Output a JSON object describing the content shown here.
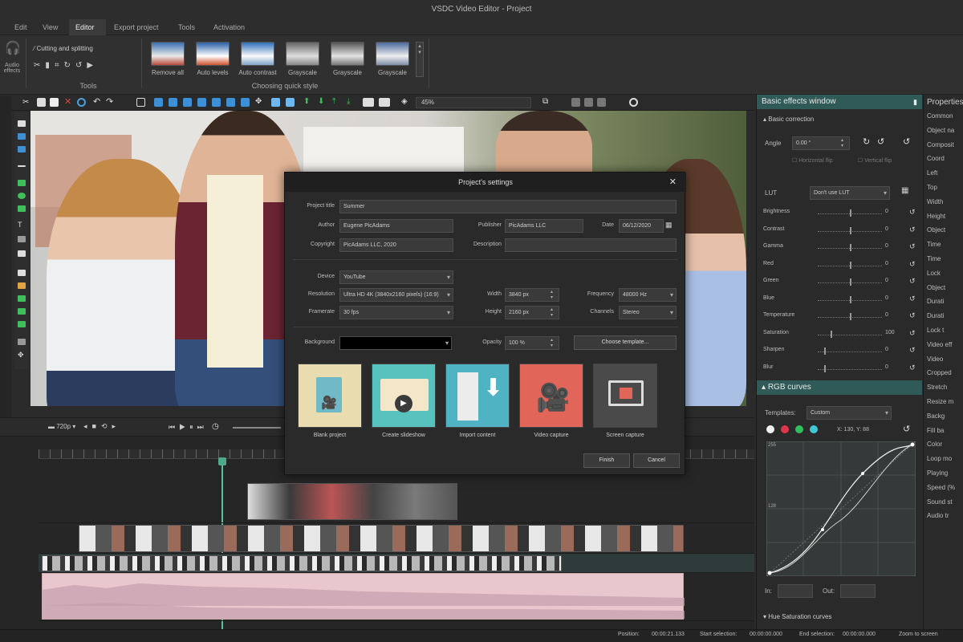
{
  "window": {
    "title": "VSDC Video Editor - Project"
  },
  "menu": {
    "items": [
      "Edit",
      "View",
      "Editor",
      "Export project",
      "Tools",
      "Activation"
    ],
    "active": "Editor"
  },
  "ribbon": {
    "audio_effects": "Audio effects",
    "cutting": "Cutting and splitting",
    "tools_label": "Tools",
    "quick_style_label": "Choosing quick style",
    "quick_styles": [
      "Remove all",
      "Auto levels",
      "Auto contrast",
      "Grayscale",
      "Grayscale",
      "Grayscale"
    ]
  },
  "toolbar": {
    "zoom": "45%"
  },
  "dialog": {
    "title": "Project's settings",
    "labels": {
      "project_title": "Project title",
      "author": "Author",
      "publisher": "Publisher",
      "date": "Date",
      "copyright": "Copyright",
      "description": "Description",
      "device": "Device",
      "resolution": "Resolution",
      "width": "Width",
      "frequency": "Frequency",
      "framerate": "Framerate",
      "height": "Height",
      "channels": "Channels",
      "background": "Background",
      "opacity": "Opacity"
    },
    "values": {
      "project_title": "Summer",
      "author": "Eugene PicAdams",
      "publisher": "PicAdams LLC",
      "date": "06/12/2020",
      "copyright": "PicAdams LLC, 2020",
      "description": "",
      "device": "YouTube",
      "resolution": "Ultra HD 4K (3840x2160 pixels) (16:9)",
      "width": "3840 px",
      "frequency": "48000 Hz",
      "framerate": "30 fps",
      "height": "2160 px",
      "channels": "Stereo",
      "background": "",
      "opacity": "100 %"
    },
    "choose_template": "Choose template...",
    "tiles": [
      "Blank project",
      "Create slideshow",
      "Import content",
      "Video capture",
      "Screen capture"
    ],
    "finish": "Finish",
    "cancel": "Cancel"
  },
  "transport": {
    "quality": "720p"
  },
  "effects": {
    "title": "Basic effects window",
    "basic_correction": "Basic correction",
    "angle_label": "Angle",
    "angle_value": "0.00 °",
    "horizontal_flip": "Horizontal flip",
    "vertical_flip": "Vertical flip",
    "lut_label": "LUT",
    "lut_value": "Don't use LUT",
    "sliders": [
      {
        "name": "Brightness",
        "value": "0",
        "pos": 0.5
      },
      {
        "name": "Contrast",
        "value": "0",
        "pos": 0.5
      },
      {
        "name": "Gamma",
        "value": "0",
        "pos": 0.5
      },
      {
        "name": "Red",
        "value": "0",
        "pos": 0.5
      },
      {
        "name": "Green",
        "value": "0",
        "pos": 0.5
      },
      {
        "name": "Blue",
        "value": "0",
        "pos": 0.5
      },
      {
        "name": "Temperature",
        "value": "0",
        "pos": 0.5
      },
      {
        "name": "Saturation",
        "value": "100",
        "pos": 0.2
      },
      {
        "name": "Sharpen",
        "value": "0",
        "pos": 0.1
      },
      {
        "name": "Blur",
        "value": "0",
        "pos": 0.1
      }
    ],
    "rgb_title": "RGB curves",
    "templates_label": "Templates:",
    "templates_value": "Custom",
    "coords": "X: 130, Y: 88",
    "curve_axis_top": "255",
    "curve_axis_mid": "128",
    "in_label": "In:",
    "out_label": "Out:",
    "hue_saturation": "Hue Saturation curves"
  },
  "properties": {
    "title": "Properties window",
    "items": [
      "Common",
      "Object na",
      "Composit",
      "Coord",
      "Left",
      "Top",
      "Width",
      "Height",
      "Object",
      "Time",
      "Time",
      "Lock",
      "Object",
      "Durati",
      "Durati",
      "Lock t",
      "Video eff",
      "Video",
      "Cropped",
      "Stretch",
      "Resize m",
      "Backg",
      "Fill ba",
      "Color",
      "Loop mo",
      "Playing",
      "Speed (%",
      "Sound st",
      "Audio tr"
    ]
  },
  "status": {
    "position_label": "Position:",
    "position": "00:00:21.133",
    "start_label": "Start selection:",
    "start": "00:00:00.000",
    "end_label": "End selection:",
    "end": "00:00:00.000",
    "zoom": "Zoom to screen"
  }
}
